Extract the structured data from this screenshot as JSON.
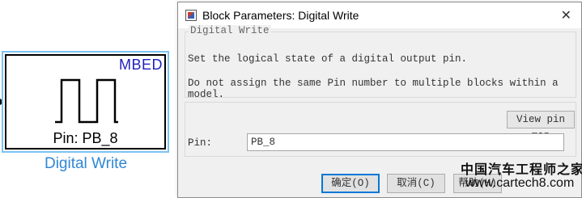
{
  "block": {
    "library_tag": "MBED",
    "pin_text": "Pin: PB_8",
    "name": "Digital Write",
    "icon": "square-wave-icon"
  },
  "dialog": {
    "title": "Block Parameters: Digital Write",
    "title_icon": "block-parameters-icon",
    "close_glyph": "✕",
    "group_title": "Digital Write",
    "description_line1": "Set the logical state of a digital output pin.",
    "description_line2": "Do not assign the same Pin number to multiple blocks within a model.",
    "view_pin_map_label": "View pin map",
    "pin_label": "Pin:",
    "pin_value": "PB_8",
    "ok_label": "确定(O)",
    "cancel_label": "取消(C)",
    "help_label": "帮助(H)"
  },
  "watermark": {
    "chinese": "中国汽车工程师之家",
    "url": "www.cartech8.com"
  },
  "colors": {
    "block_tag": "#1f1fbf",
    "block_name": "#2f87d6",
    "block_selection": "#7cc3f2",
    "dialog_bg": "#f0f0f0",
    "default_button_border": "#0078d7"
  }
}
